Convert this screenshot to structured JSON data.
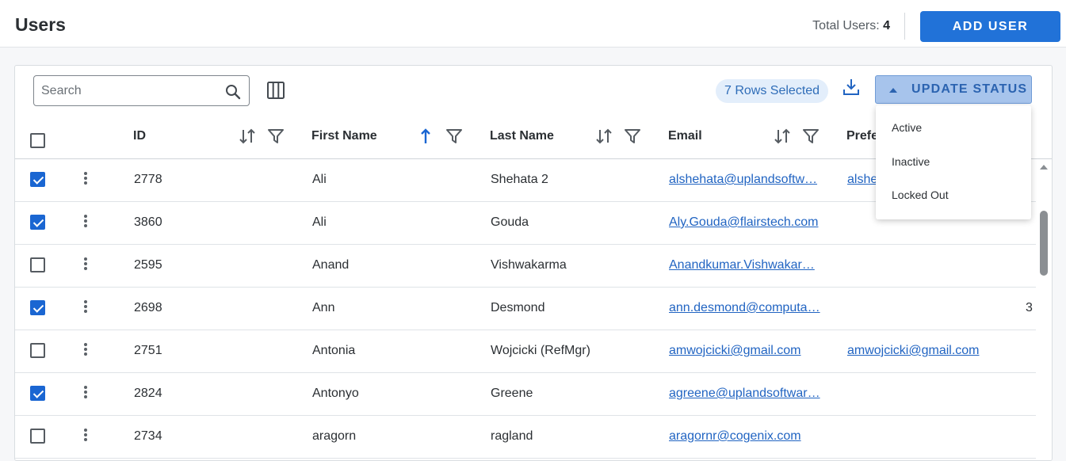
{
  "header": {
    "title": "Users",
    "total_label": "Total Users:",
    "total_count": "4",
    "add_button": "ADD USER"
  },
  "toolbar": {
    "search_placeholder": "Search",
    "rows_selected": "7 Rows Selected",
    "update_status": "UPDATE STATUS"
  },
  "status_menu": [
    "Active",
    "Inactive",
    "Locked Out"
  ],
  "columns": {
    "id": "ID",
    "first_name": "First Name",
    "last_name": "Last Name",
    "email": "Email",
    "preferred": "Prefe"
  },
  "rows": [
    {
      "checked": true,
      "id": "2778",
      "first": "Ali",
      "last": "Shehata 2",
      "email": "alshehata@uplandsoftw…",
      "pref": "alshe",
      "extra": ""
    },
    {
      "checked": true,
      "id": "3860",
      "first": "Ali",
      "last": "Gouda",
      "email": "Aly.Gouda@flairstech.com",
      "pref": "",
      "extra": ""
    },
    {
      "checked": false,
      "id": "2595",
      "first": "Anand",
      "last": "Vishwakarma",
      "email": "Anandkumar.Vishwakar…",
      "pref": "",
      "extra": ""
    },
    {
      "checked": true,
      "id": "2698",
      "first": "Ann",
      "last": "Desmond",
      "email": "ann.desmond@computa…",
      "pref": "",
      "extra": "3"
    },
    {
      "checked": false,
      "id": "2751",
      "first": "Antonia",
      "last": "Wojcicki (RefMgr)",
      "email": "amwojcicki@gmail.com",
      "pref": "amwojcicki@gmail.com",
      "extra": ""
    },
    {
      "checked": true,
      "id": "2824",
      "first": "Antonyo",
      "last": "Greene",
      "email": "agreene@uplandsoftwar…",
      "pref": "",
      "extra": ""
    },
    {
      "checked": false,
      "id": "2734",
      "first": "aragorn",
      "last": "ragland",
      "email": "aragornr@cogenix.com",
      "pref": "",
      "extra": ""
    }
  ],
  "colors": {
    "primary": "#2172d8",
    "checkbox": "#1a66d2",
    "link": "#2164c2"
  }
}
